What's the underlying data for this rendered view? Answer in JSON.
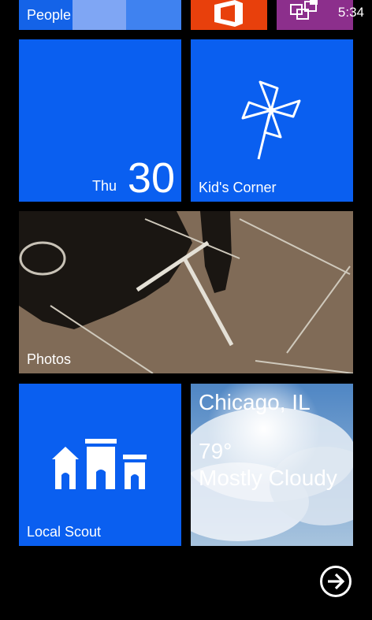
{
  "status_bar": {
    "time": "5:34"
  },
  "tiles": {
    "people": {
      "label": "People"
    },
    "calendar": {
      "day": "Thu",
      "date": "30"
    },
    "kids_corner": {
      "label": "Kid's Corner"
    },
    "photos": {
      "label": "Photos"
    },
    "local_scout": {
      "label": "Local Scout"
    },
    "weather": {
      "city": "Chicago, IL",
      "temp": "79°",
      "condition": "Mostly Cloudy"
    }
  },
  "icons": {
    "office": "office-icon",
    "store": "store-icon",
    "pinwheel": "pinwheel-icon",
    "local_scout": "buildings-icon",
    "more": "arrow-right-circle-icon"
  },
  "colors": {
    "accent": "#0a5ff0",
    "office": "#e8400c",
    "store": "#8c2f8c",
    "background": "#000000"
  }
}
